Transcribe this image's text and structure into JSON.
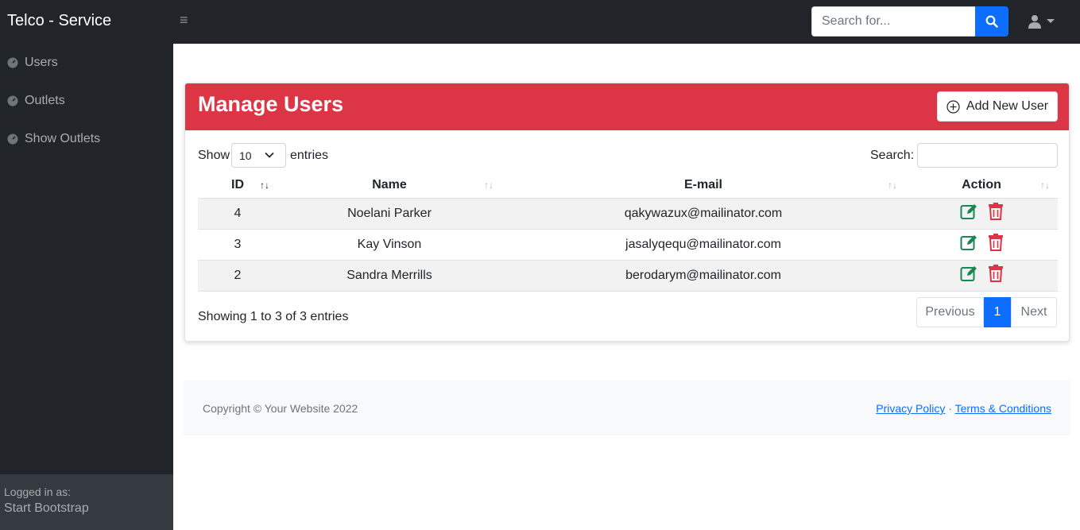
{
  "app": {
    "brand": "Telco - Service"
  },
  "topbar": {
    "search_placeholder": "Search for..."
  },
  "sidebar": {
    "items": [
      {
        "label": "Users"
      },
      {
        "label": "Outlets"
      },
      {
        "label": "Show Outlets"
      }
    ],
    "footer_label": "Logged in as:",
    "footer_user": "Start Bootstrap"
  },
  "card": {
    "title": "Manage Users",
    "add_button": "Add New User",
    "length": {
      "before": "Show",
      "value": "10",
      "after": "entries"
    },
    "search_label": "Search:",
    "columns": [
      "ID",
      "Name",
      "E-mail",
      "Action"
    ],
    "rows": [
      {
        "id": "4",
        "name": "Noelani Parker",
        "email": "qakywazux@mailinator.com"
      },
      {
        "id": "3",
        "name": "Kay Vinson",
        "email": "jasalyqequ@mailinator.com"
      },
      {
        "id": "2",
        "name": "Sandra Merrills",
        "email": "berodarym@mailinator.com"
      }
    ],
    "info": "Showing 1 to 3 of 3 entries",
    "pagination": {
      "previous": "Previous",
      "current": "1",
      "next": "Next"
    }
  },
  "footer": {
    "copyright": "Copyright © Your Website 2022",
    "privacy": "Privacy Policy",
    "separator": "·",
    "terms": "Terms & Conditions"
  },
  "colors": {
    "danger": "#dc3545",
    "primary": "#0d6efd",
    "success": "#198754",
    "dark": "#212529"
  }
}
